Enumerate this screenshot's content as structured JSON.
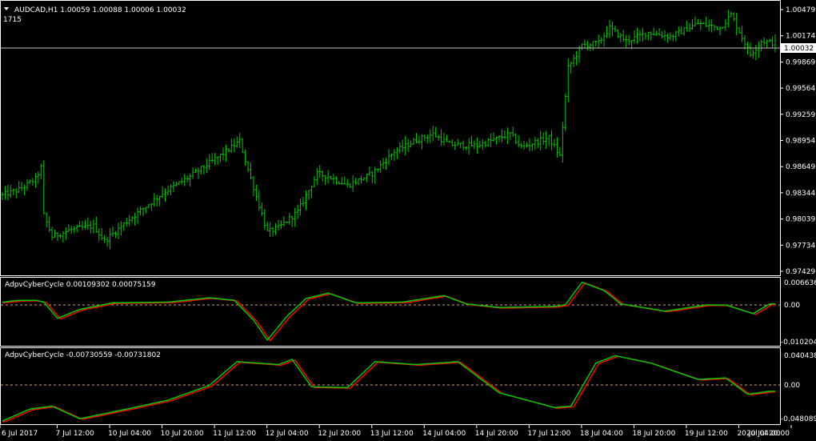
{
  "main": {
    "title": "AUDCAD,H1  1.00059 1.00088 1.00006 1.00032",
    "subtitle": "1715",
    "current_price": "1.00032",
    "price_labels": [
      "1.00479",
      "1.00174",
      "0.99869",
      "0.99564",
      "0.99259",
      "0.98954",
      "0.98649",
      "0.98344",
      "0.98039",
      "0.97734",
      "0.97429"
    ]
  },
  "indicators": [
    {
      "title": "AdpvCyberCycle 0.00109302 0.00075159",
      "top_label": "0.006636",
      "mid_label": "0.00",
      "bottom_label": "-0.010204"
    },
    {
      "title": "AdpvCyberCycle -0.00730559 -0.00731802",
      "top_label": "0.040438",
      "mid_label": "0.00",
      "bottom_label": "-0.048089"
    }
  ],
  "time_labels": [
    "6 Jul 2017",
    "7 Jul 12:00",
    "10 Jul 04:00",
    "10 Jul 20:00",
    "11 Jul 12:00",
    "12 Jul 04:00",
    "12 Jul 20:00",
    "13 Jul 12:00",
    "14 Jul 04:00",
    "14 Jul 20:00",
    "17 Jul 12:00",
    "18 Jul 04:00",
    "18 Jul 20:00",
    "19 Jul 12:00",
    "20 Jul 04:00",
    "20 Jul 20:00"
  ],
  "colors": {
    "background": "#000000",
    "frame": "#ffffff",
    "bars": "#00c800",
    "cycle_line": "#00c800",
    "trigger_line": "#ff0000",
    "zero_level": "#e8a050",
    "price_line": "#c0c0c0"
  },
  "chart_data": {
    "type": "line",
    "symbol": "AUDCAD",
    "timeframe": "H1",
    "ylim": [
      0.97429,
      1.00479
    ],
    "close_path": [
      [
        0,
        0.9831
      ],
      [
        6,
        0.9837
      ],
      [
        12,
        0.9849
      ],
      [
        14,
        0.9862
      ],
      [
        15,
        0.9808
      ],
      [
        18,
        0.9784
      ],
      [
        25,
        0.9792
      ],
      [
        33,
        0.9796
      ],
      [
        37,
        0.9779
      ],
      [
        45,
        0.9801
      ],
      [
        58,
        0.9833
      ],
      [
        68,
        0.9852
      ],
      [
        80,
        0.9878
      ],
      [
        86,
        0.9892
      ],
      [
        88,
        0.987
      ],
      [
        96,
        0.9789
      ],
      [
        100,
        0.9794
      ],
      [
        107,
        0.9812
      ],
      [
        114,
        0.9855
      ],
      [
        118,
        0.9852
      ],
      [
        125,
        0.9842
      ],
      [
        134,
        0.9855
      ],
      [
        142,
        0.988
      ],
      [
        150,
        0.9893
      ],
      [
        156,
        0.99
      ],
      [
        162,
        0.9888
      ],
      [
        172,
        0.9887
      ],
      [
        184,
        0.99
      ],
      [
        188,
        0.9885
      ],
      [
        198,
        0.9896
      ],
      [
        202,
        0.9875
      ],
      [
        205,
        0.9975
      ],
      [
        210,
        1.0
      ],
      [
        216,
        1.0003
      ],
      [
        220,
        1.002
      ],
      [
        226,
        1.0005
      ],
      [
        234,
        1.0015
      ],
      [
        242,
        1.001
      ],
      [
        252,
        1.0025
      ],
      [
        260,
        1.002
      ],
      [
        264,
        1.0035
      ],
      [
        271,
        0.999
      ],
      [
        275,
        1.0005
      ],
      [
        280,
        1.0003
      ]
    ],
    "cycle1_path": [
      [
        0,
        0.001
      ],
      [
        6,
        0.0015
      ],
      [
        12,
        0.0015
      ],
      [
        15,
        0.001
      ],
      [
        20,
        -0.0035
      ],
      [
        28,
        -0.001
      ],
      [
        40,
        0.0008
      ],
      [
        60,
        0.001
      ],
      [
        75,
        0.0022
      ],
      [
        84,
        0.0015
      ],
      [
        91,
        -0.004
      ],
      [
        96,
        -0.0095
      ],
      [
        103,
        -0.003
      ],
      [
        110,
        0.002
      ],
      [
        118,
        0.0035
      ],
      [
        128,
        0.0008
      ],
      [
        145,
        0.001
      ],
      [
        160,
        0.0028
      ],
      [
        168,
        0.0005
      ],
      [
        180,
        -0.0005
      ],
      [
        200,
        -0.0002
      ],
      [
        204,
        0.0003
      ],
      [
        210,
        0.0065
      ],
      [
        218,
        0.0042
      ],
      [
        224,
        0.0005
      ],
      [
        240,
        -0.0015
      ],
      [
        255,
        0.0002
      ],
      [
        262,
        0.0002
      ],
      [
        272,
        -0.0022
      ],
      [
        278,
        0.0005
      ]
    ],
    "cycle2_path": [
      [
        0,
        -0.048
      ],
      [
        10,
        -0.032
      ],
      [
        18,
        -0.028
      ],
      [
        28,
        -0.045
      ],
      [
        45,
        -0.032
      ],
      [
        60,
        -0.02
      ],
      [
        75,
        0.0
      ],
      [
        85,
        0.032
      ],
      [
        100,
        0.028
      ],
      [
        105,
        0.035
      ],
      [
        112,
        -0.002
      ],
      [
        125,
        -0.003
      ],
      [
        135,
        0.032
      ],
      [
        150,
        0.028
      ],
      [
        165,
        0.032
      ],
      [
        180,
        -0.01
      ],
      [
        200,
        -0.03
      ],
      [
        206,
        -0.028
      ],
      [
        215,
        0.03
      ],
      [
        222,
        0.04
      ],
      [
        235,
        0.03
      ],
      [
        252,
        0.008
      ],
      [
        262,
        0.01
      ],
      [
        270,
        -0.012
      ],
      [
        278,
        -0.008
      ]
    ]
  }
}
